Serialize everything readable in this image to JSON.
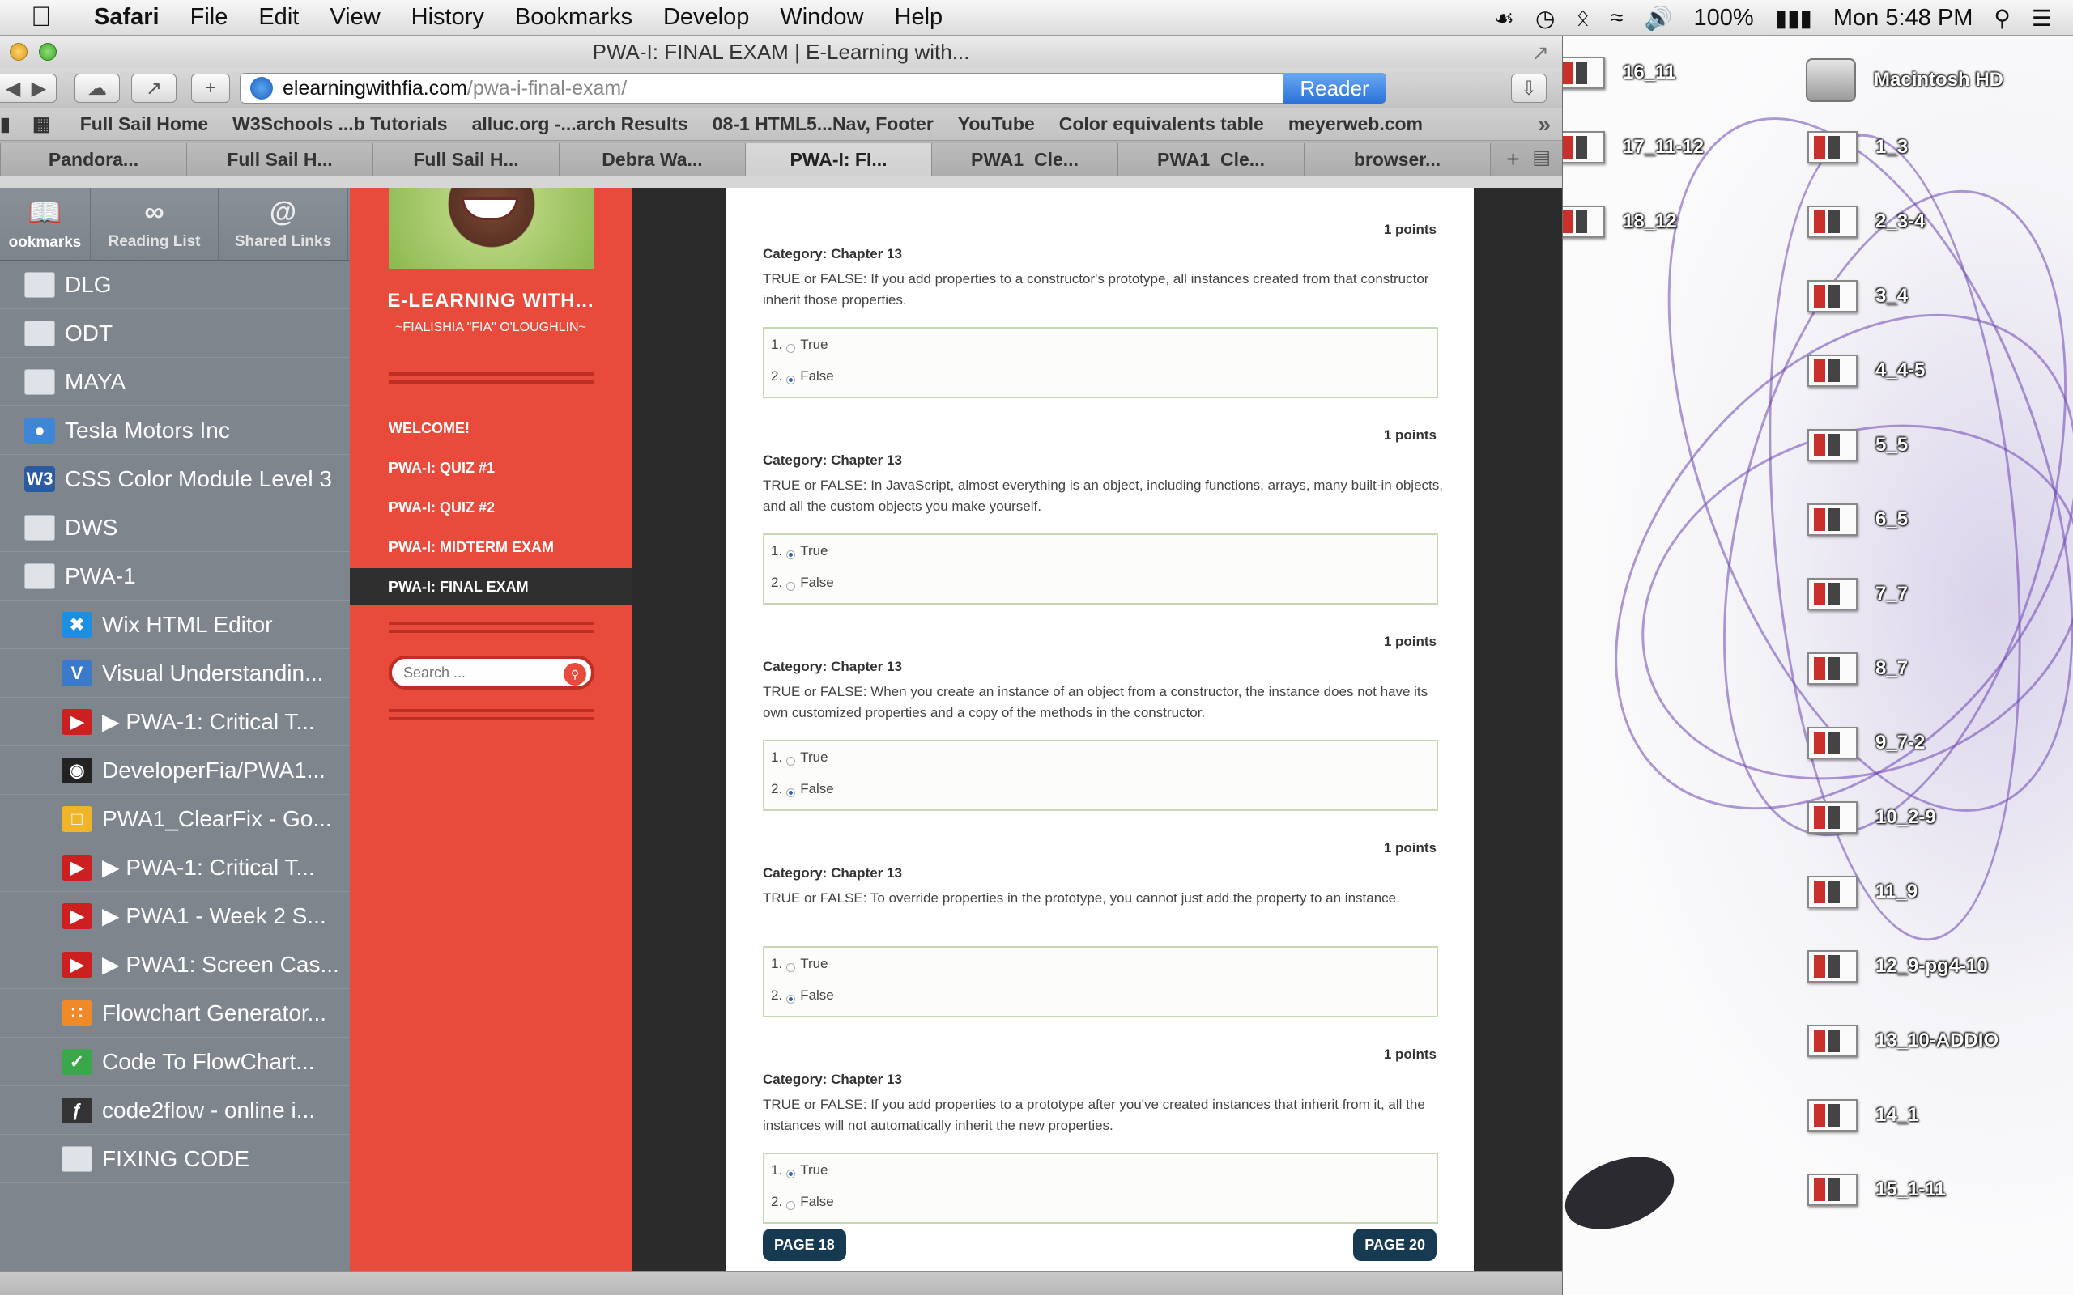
{
  "menubar": {
    "apple": "",
    "app": "Safari",
    "items": [
      "File",
      "Edit",
      "View",
      "History",
      "Bookmarks",
      "Develop",
      "Window",
      "Help"
    ],
    "battery": "100%",
    "clock": "Mon 5:48 PM"
  },
  "window": {
    "title": "PWA-I: FINAL EXAM | E-Learning with..."
  },
  "toolbar": {
    "url_host": "elearningwithfia.com",
    "url_path": "/pwa-i-final-exam/",
    "reader_label": "Reader"
  },
  "bookmarks_bar": [
    "Full Sail Home",
    "W3Schools ...b Tutorials",
    "alluc.org -...arch Results",
    "08-1 HTML5...Nav, Footer",
    "YouTube",
    "Color equivalents table",
    "meyerweb.com"
  ],
  "tabs": [
    "Pandora...",
    "Full Sail H...",
    "Full Sail H...",
    "Debra Wa...",
    "PWA-I: FI...",
    "PWA1_Cle...",
    "PWA1_Cle...",
    "browser..."
  ],
  "sidebar": {
    "tabs": [
      {
        "icon": "book-icon",
        "label": "ookmarks"
      },
      {
        "icon": "glasses-icon",
        "label": "Reading List"
      },
      {
        "icon": "at-icon",
        "label": "Shared Links"
      }
    ],
    "items": [
      {
        "label": "DLG",
        "icon": "folder-icon",
        "child": false
      },
      {
        "label": "ODT",
        "icon": "folder-icon",
        "child": false
      },
      {
        "label": "MAYA",
        "icon": "folder-icon",
        "child": false
      },
      {
        "label": "Tesla Motors Inc",
        "icon": "globe-icon",
        "child": false
      },
      {
        "label": "CSS Color Module Level 3",
        "icon": "w3c-icon",
        "child": false
      },
      {
        "label": "DWS",
        "icon": "folder-icon",
        "child": false
      },
      {
        "label": "PWA-1",
        "icon": "folder-icon",
        "child": false
      },
      {
        "label": "Wix HTML Editor",
        "icon": "wix-icon",
        "child": true
      },
      {
        "label": "Visual Understandin...",
        "icon": "v-icon",
        "child": true
      },
      {
        "label": "▶ PWA-1: Critical T...",
        "icon": "youtube-icon",
        "child": true
      },
      {
        "label": "DeveloperFia/PWA1...",
        "icon": "github-icon",
        "child": true
      },
      {
        "label": "PWA1_ClearFix - Go...",
        "icon": "slides-icon",
        "child": true
      },
      {
        "label": "▶ PWA-1: Critical T...",
        "icon": "youtube-icon",
        "child": true
      },
      {
        "label": "▶ PWA1 - Week 2 S...",
        "icon": "youtube-icon",
        "child": true
      },
      {
        "label": "▶ PWA1: Screen Cas...",
        "icon": "youtube-icon",
        "child": true
      },
      {
        "label": "Flowchart Generator...",
        "icon": "flowchart-icon",
        "child": true
      },
      {
        "label": "Code To FlowChart...",
        "icon": "code-flowchart-icon",
        "child": true
      },
      {
        "label": "code2flow - online i...",
        "icon": "code2flow-icon",
        "child": true
      },
      {
        "label": "FIXING CODE",
        "icon": "folder-icon",
        "child": true
      }
    ]
  },
  "site": {
    "title": "E-LEARNING WITH...",
    "subtitle": "~FIALISHIA \"FIA\" O'LOUGHLIN~",
    "nav": [
      "WELCOME!",
      "PWA-I: QUIZ #1",
      "PWA-I: QUIZ #2",
      "PWA-I: MIDTERM EXAM",
      "PWA-I: FINAL EXAM"
    ],
    "search_placeholder": "Search ..."
  },
  "exam": {
    "top_points": "1 points",
    "questions": [
      {
        "category": "Category: Chapter 13",
        "text": "TRUE or FALSE:  If you add properties to a constructor's prototype, all instances created from that constructor inherit those properties.",
        "options": [
          "True",
          "False"
        ],
        "selected": 1,
        "points_after": "1 points"
      },
      {
        "category": "Category: Chapter 13",
        "text": "TRUE or FALSE:  In JavaScript, almost everything is an object, including functions, arrays, many built-in objects, and all the custom objects you make yourself.",
        "options": [
          "True",
          "False"
        ],
        "selected": 0,
        "points_after": "1 points"
      },
      {
        "category": "Category: Chapter 13",
        "text": "TRUE or FALSE:  When you create an instance of an object from a constructor, the instance does not have its own customized properties and a copy of the methods in the constructor.",
        "options": [
          "True",
          "False"
        ],
        "selected": 1,
        "points_after": "1 points"
      },
      {
        "category": "Category: Chapter 13",
        "text": "TRUE or FALSE: To override properties in the prototype, you cannot just add the property to an instance.",
        "options": [
          "True",
          "False"
        ],
        "selected": 1,
        "points_after": "1 points"
      },
      {
        "category": "Category: Chapter 13",
        "text": "TRUE or FALSE:  If you add properties to a prototype after you've created instances that inherit from it, all the instances will not automatically inherit the new properties.",
        "options": [
          "True",
          "False"
        ],
        "selected": 0,
        "points_after": ""
      }
    ],
    "prev_page": "PAGE 18",
    "next_page": "PAGE 20"
  },
  "desktop": {
    "hd_label": "Macintosh HD",
    "left_column": [
      "16_11",
      "17_11-12",
      "18_12"
    ],
    "right_column": [
      "1_3",
      "2_3-4",
      "3_4",
      "4_4-5",
      "5_5",
      "6_5",
      "7_7",
      "8_7",
      "9_7-2",
      "10_2-9",
      "11_9",
      "12_9-pg4-10",
      "13_10-ADDIO",
      "14_1",
      "15_1-11"
    ]
  }
}
